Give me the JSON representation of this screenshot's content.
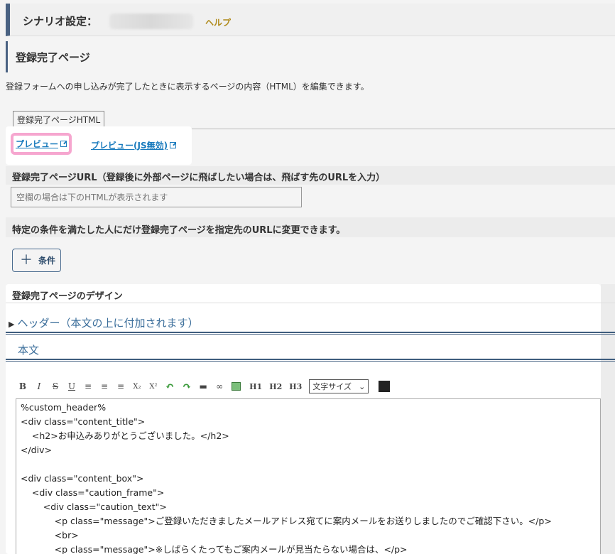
{
  "scenario": {
    "title": "シナリオ設定：",
    "help": "ヘルプ"
  },
  "section": {
    "heading": "登録完了ページ",
    "description": "登録フォームへの申し込みが完了したときに表示するページの内容（HTML）を編集できます。",
    "tab": "登録完了ページHTML"
  },
  "preview": {
    "link1": "プレビュー",
    "link2": "プレビュー(JS無効)"
  },
  "url": {
    "label": "登録完了ページURL（登録後に外部ページに飛ばしたい場合は、飛ばす先のURLを入力）",
    "placeholder": "空欄の場合は下のHTMLが表示されます"
  },
  "condition": {
    "label": "特定の条件を満たした人にだけ登録完了ページを指定先のURLに変更できます。",
    "button": "条件",
    "button_icon": "plus-icon"
  },
  "design": {
    "title": "登録完了ページのデザイン",
    "header_toggle": "ヘッダー（本文の上に付加されます）",
    "body_label": "本文"
  },
  "toolbar": {
    "bold": "B",
    "italic": "I",
    "strike": "S",
    "underline": "U",
    "sub": "X₂",
    "sup": "X²",
    "h1": "H1",
    "h2": "H2",
    "h3": "H3",
    "font_size": "文字サイズ"
  },
  "code_lines": [
    "%custom_header%",
    "<div class=\"content_title\">",
    "    <h2>お申込みありがとうございました。</h2>",
    "</div>",
    "",
    "<div class=\"content_box\">",
    "    <div class=\"caution_frame\">",
    "        <div class=\"caution_text\">",
    "            <p class=\"message\">ご登録いただきましたメールアドレス宛てに案内メールをお送りしましたのでご確認下さい。</p>",
    "            <br>",
    "            <p class=\"message\">※しばらくたってもご案内メールが見当たらない場合は、</p>"
  ],
  "colors": {
    "accent": "#4a6282",
    "link": "#1a7bbd",
    "highlight": "#f6a6cf",
    "help": "#b08a1a"
  }
}
